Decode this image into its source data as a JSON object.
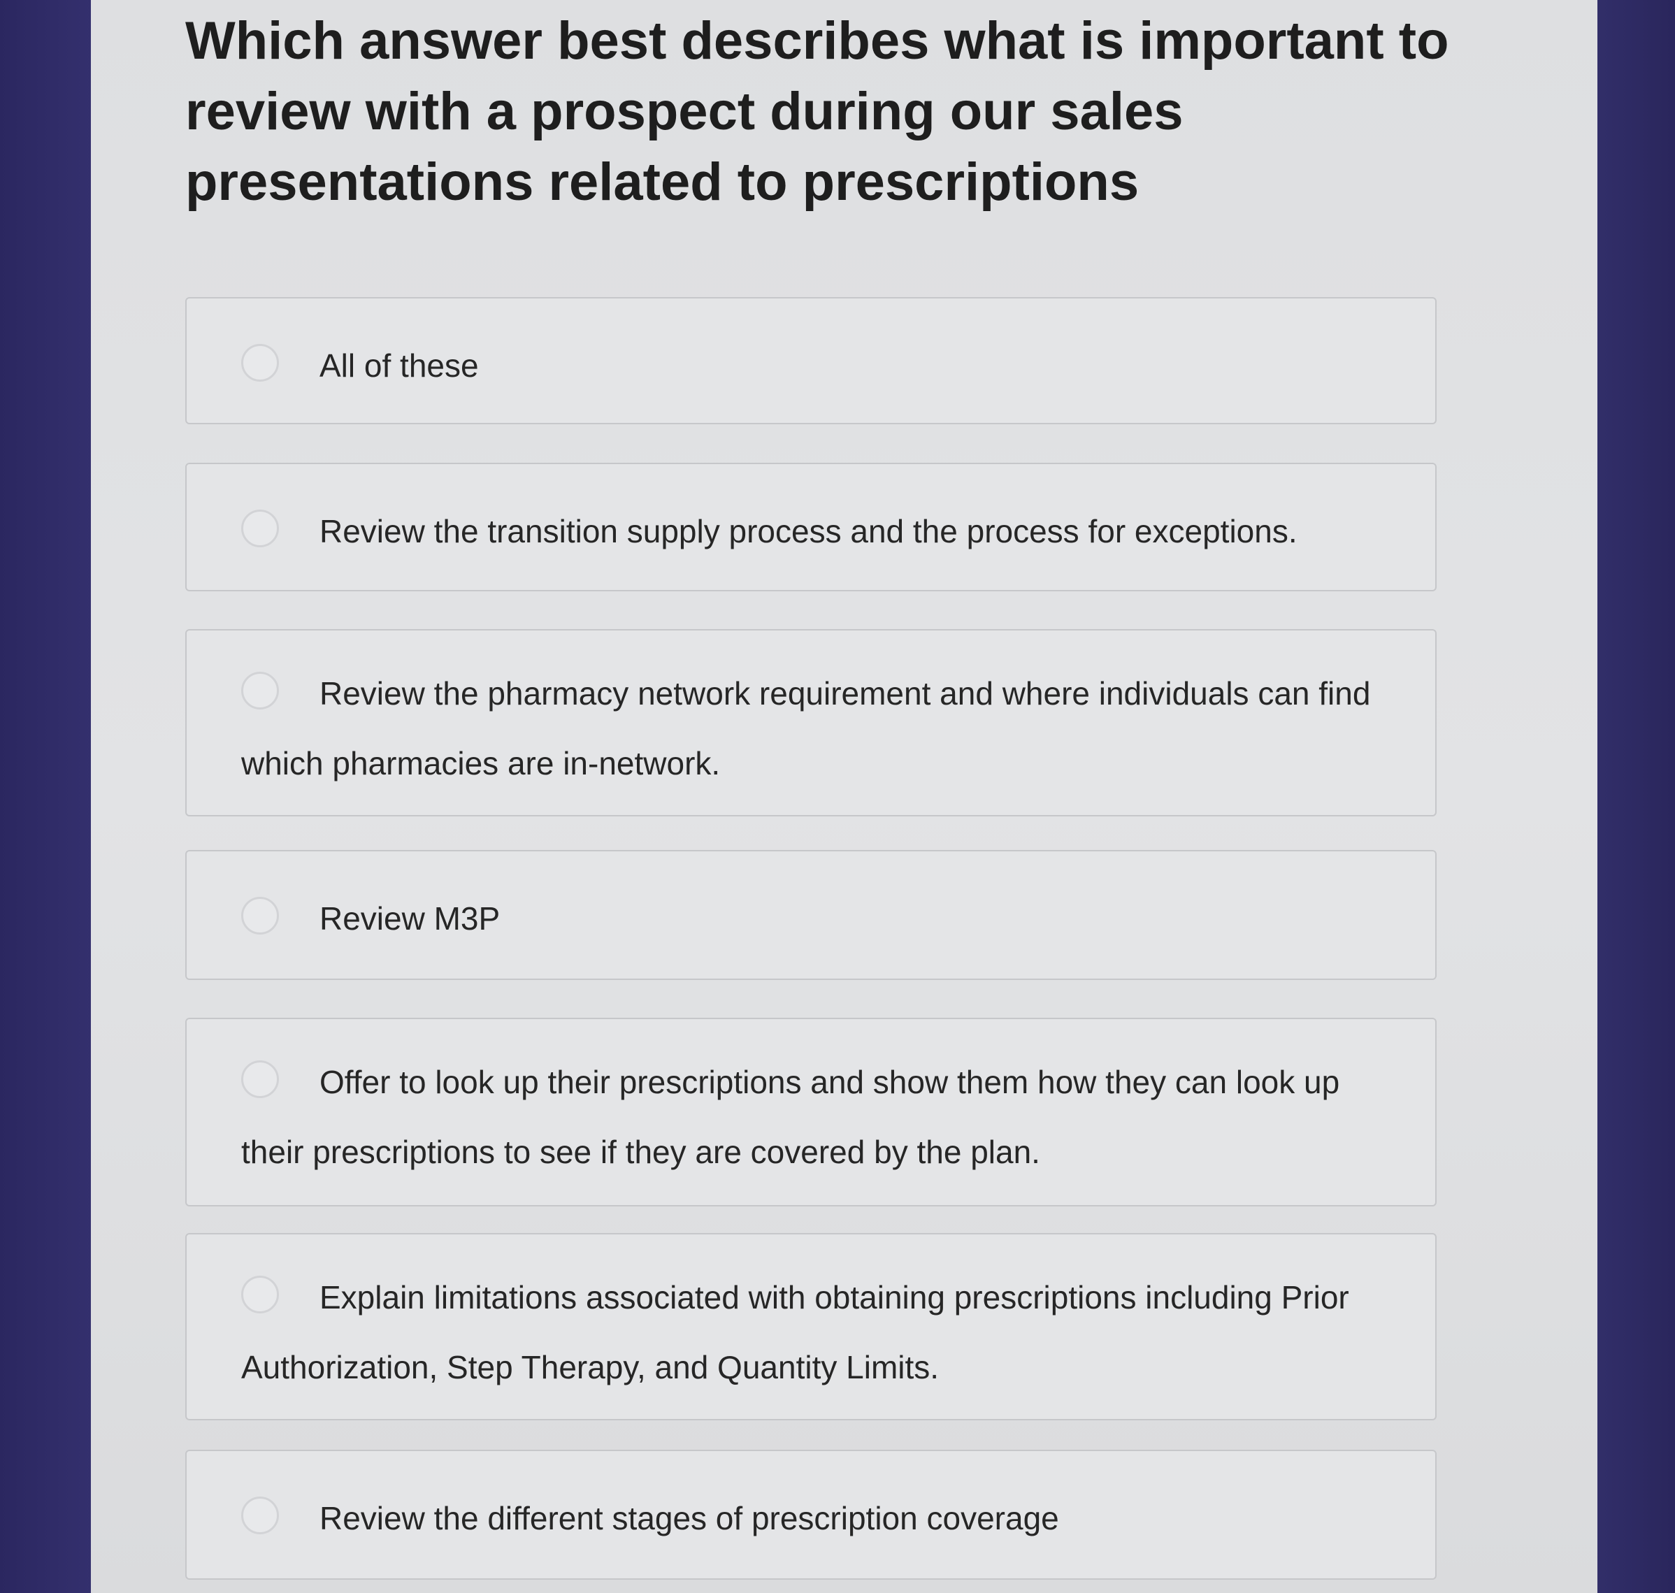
{
  "question": {
    "text": "Which answer best describes what is important to review with a prospect during our sales presentations related to prescriptions"
  },
  "options": [
    {
      "label": "All of these",
      "selected": false
    },
    {
      "label": "Review the transition supply process and the process for exceptions.",
      "selected": false
    },
    {
      "label": "Review the pharmacy network requirement and where individuals can find which pharmacies are in-network.",
      "selected": false
    },
    {
      "label": "Review M3P",
      "selected": false
    },
    {
      "label": "Offer to look up their prescriptions and show them how they can look up their prescriptions to see if they are covered by the plan.",
      "selected": false
    },
    {
      "label": "Explain limitations associated with obtaining prescriptions including Prior Authorization, Step Therapy, and Quantity Limits.",
      "selected": false
    },
    {
      "label": "Review the different stages of prescription coverage",
      "selected": false
    }
  ]
}
